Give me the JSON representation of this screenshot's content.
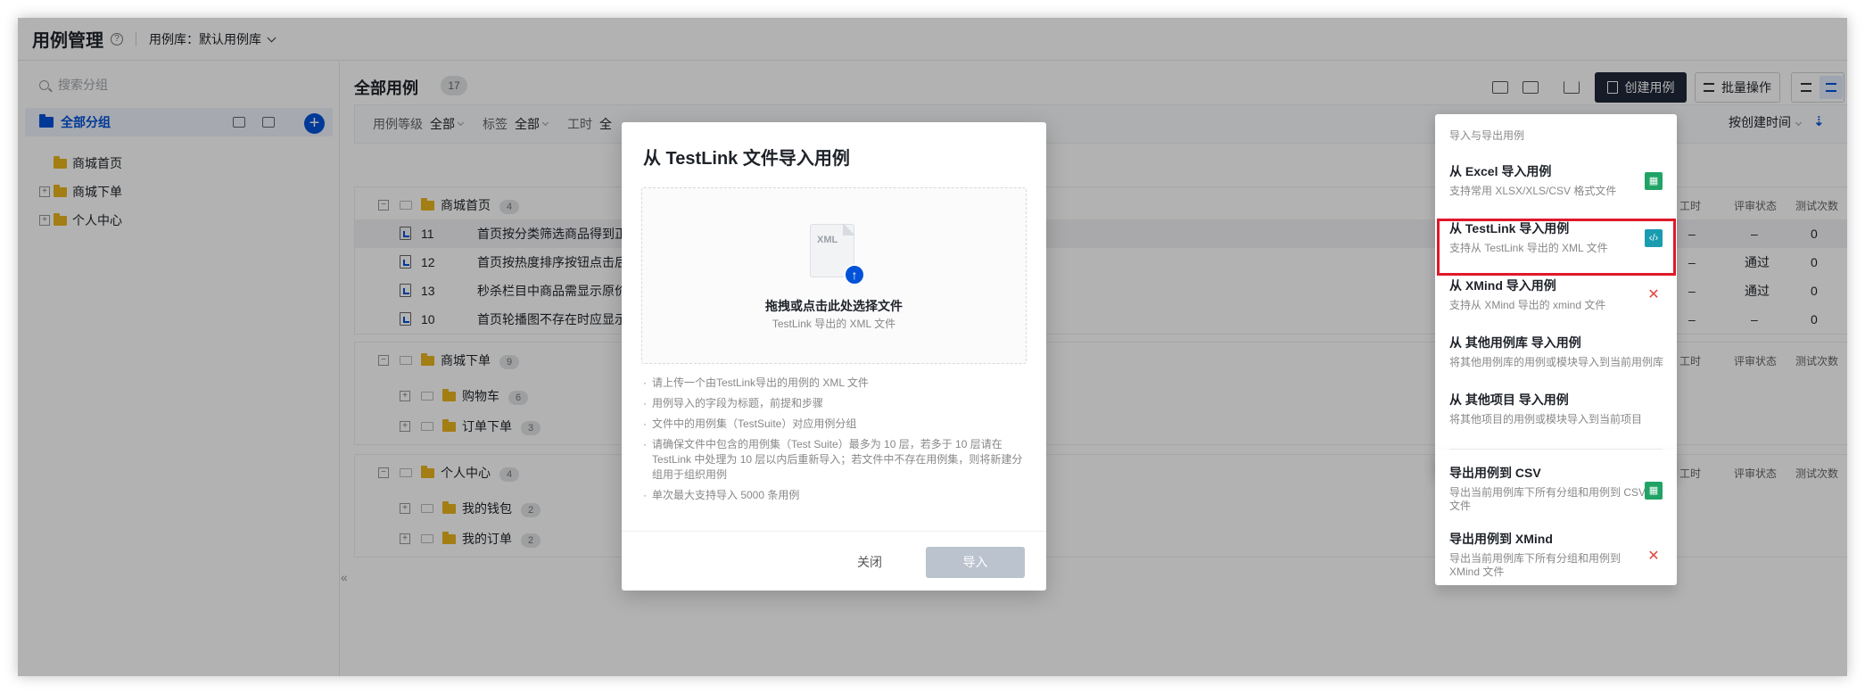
{
  "app": {
    "title": "用例管理",
    "library_label": "用例库：",
    "library_value": "默认用例库"
  },
  "sidebar": {
    "search_placeholder": "搜索分组",
    "all_groups": "全部分组",
    "tree": [
      {
        "label": "商城首页",
        "expandable": false
      },
      {
        "label": "商城下单",
        "expandable": true
      },
      {
        "label": "个人中心",
        "expandable": true
      }
    ]
  },
  "main": {
    "title": "全部用例",
    "count": "17",
    "create_button": "创建用例",
    "batch_button": "批量操作",
    "filters": [
      {
        "label": "用例等级",
        "value": "全部"
      },
      {
        "label": "标签",
        "value": "全部"
      },
      {
        "label": "工时",
        "value": "全"
      }
    ],
    "sort_label": "按创建时间",
    "columns": {
      "hours": "工时",
      "review": "评审状态",
      "tests": "测试次数"
    },
    "groups": [
      {
        "name": "商城首页",
        "count": "4",
        "cases": [
          {
            "id": "11",
            "title": "首页按分类筛选商品得到正",
            "hours": "–",
            "review": "–",
            "tests": "0"
          },
          {
            "id": "12",
            "title": "首页按热度排序按钮点击后",
            "hours": "–",
            "review": "通过",
            "tests": "0"
          },
          {
            "id": "13",
            "title": "秒杀栏目中商品需显示原价",
            "hours": "–",
            "review": "通过",
            "tests": "0"
          },
          {
            "id": "10",
            "title": "首页轮播图不存在时应显示",
            "hours": "–",
            "review": "–",
            "tests": "0"
          }
        ]
      },
      {
        "name": "商城下单",
        "count": "9",
        "subgroups": [
          {
            "name": "购物车",
            "count": "6"
          },
          {
            "name": "订单下单",
            "count": "3"
          }
        ]
      },
      {
        "name": "个人中心",
        "count": "4",
        "subgroups": [
          {
            "name": "我的钱包",
            "count": "2"
          },
          {
            "name": "我的订单",
            "count": "2"
          }
        ]
      }
    ]
  },
  "menu": {
    "header": "导入与导出用例",
    "items": [
      {
        "title": "从 Excel 导入用例",
        "desc": "支持常用 XLSX/XLS/CSV 格式文件",
        "icon": "sheet-green-icon"
      },
      {
        "title": "从 TestLink 导入用例",
        "desc": "支持从 TestLink 导出的 XML 文件",
        "icon": "code-teal-icon"
      },
      {
        "title": "从 XMind 导入用例",
        "desc": "支持从 XMind 导出的 xmind 文件",
        "icon": "xmind-red-icon"
      },
      {
        "title": "从 其他用例库 导入用例",
        "desc": "将其他用例库的用例或模块导入到当前用例库"
      },
      {
        "title": "从 其他项目 导入用例",
        "desc": "将其他项目的用例或模块导入到当前项目"
      },
      {
        "title": "导出用例到 CSV",
        "desc": "导出当前用例库下所有分组和用例到 CSV 文件",
        "icon": "sheet-green-icon"
      },
      {
        "title": "导出用例到 XMind",
        "desc": "导出当前用例库下所有分组和用例到 XMind 文件",
        "icon": "xmind-red-icon"
      }
    ]
  },
  "modal": {
    "title": "从 TestLink 文件导入用例",
    "file_badge": "XML",
    "drop_title": "拖拽或点击此处选择文件",
    "drop_sub": "TestLink 导出的 XML 文件",
    "notes": [
      "请上传一个由TestLink导出的用例的 XML 文件",
      "用例导入的字段为标题，前提和步骤",
      "文件中的用例集（TestSuite）对应用例分组",
      "请确保文件中包含的用例集（Test Suite）最多为 10 层，若多于 10 层请在 TestLink 中处理为 10 层以内后重新导入；若文件中不存在用例集，则将新建分组用于组织用例",
      "单次最大支持导入 5000 条用例"
    ],
    "close_button": "关闭",
    "import_button": "导入"
  },
  "colors": {
    "primary": "#0052d9",
    "dark_button": "#1f2838",
    "highlight": "#e0182b",
    "folder": "#e8b51e",
    "excel": "#21a366",
    "testlink": "#1a9cb0",
    "xmind": "#e0463e"
  }
}
